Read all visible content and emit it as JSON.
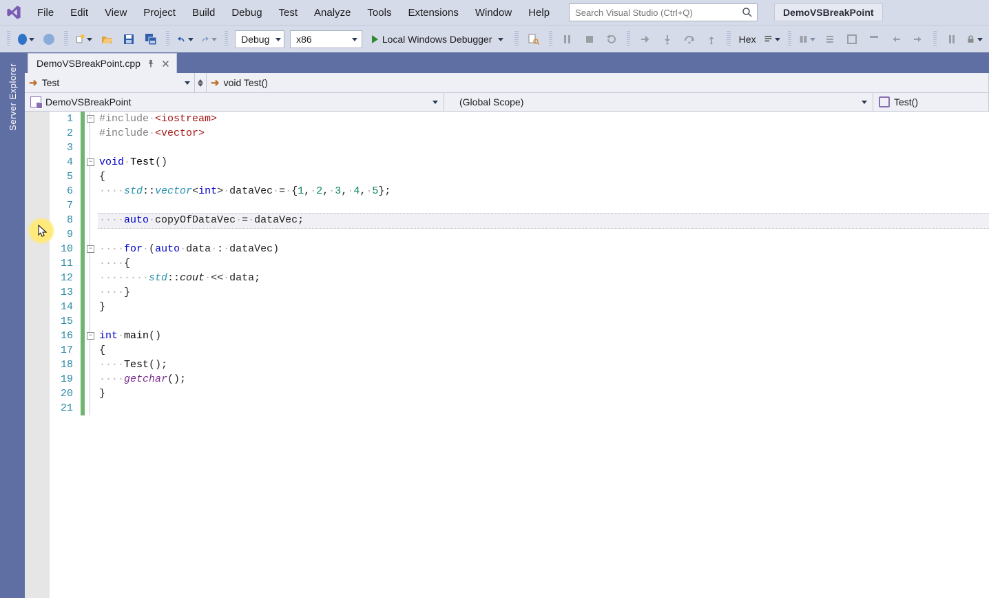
{
  "app": {
    "solution_name": "DemoVSBreakPoint",
    "search_placeholder": "Search Visual Studio (Ctrl+Q)"
  },
  "menus": [
    "File",
    "Edit",
    "View",
    "Project",
    "Build",
    "Debug",
    "Test",
    "Analyze",
    "Tools",
    "Extensions",
    "Window",
    "Help"
  ],
  "toolbar": {
    "config": "Debug",
    "platform": "x86",
    "debugger_label": "Local Windows Debugger",
    "hex_label": "Hex"
  },
  "sidepanel": {
    "server_explorer": "Server Explorer"
  },
  "tab": {
    "filename": "DemoVSBreakPoint.cpp"
  },
  "nav": {
    "class_combo": "Test",
    "func_combo": "void Test()"
  },
  "scope": {
    "project": "DemoVSBreakPoint",
    "scope": "(Global Scope)",
    "function": "Test()"
  },
  "code": {
    "highlight_line": 8,
    "lines": [
      {
        "n": 1,
        "outline": "minus",
        "seg": [
          [
            "pre",
            "#include"
          ],
          [
            "dots",
            "·"
          ],
          [
            "str",
            "<iostream>"
          ]
        ]
      },
      {
        "n": 2,
        "seg": [
          [
            "pre",
            "#include"
          ],
          [
            "dots",
            "·"
          ],
          [
            "str",
            "<vector>"
          ]
        ]
      },
      {
        "n": 3,
        "seg": []
      },
      {
        "n": 4,
        "outline": "minus",
        "seg": [
          [
            "kw",
            "void"
          ],
          [
            "dots",
            "·"
          ],
          [
            "fn",
            "Test"
          ],
          [
            "id",
            "()"
          ]
        ]
      },
      {
        "n": 5,
        "seg": [
          [
            "id",
            "{"
          ]
        ]
      },
      {
        "n": 6,
        "seg": [
          [
            "dots",
            "····"
          ],
          [
            "em",
            "std"
          ],
          [
            "id",
            "::"
          ],
          [
            "em",
            "vector"
          ],
          [
            "id",
            "<"
          ],
          [
            "kw",
            "int"
          ],
          [
            "id",
            ">"
          ],
          [
            "dots",
            "·"
          ],
          [
            "id",
            "dataVec"
          ],
          [
            "dots",
            "·"
          ],
          [
            "id",
            "="
          ],
          [
            "dots",
            "·"
          ],
          [
            "id",
            "{"
          ],
          [
            "num",
            "1"
          ],
          [
            "id",
            ","
          ],
          [
            "dots",
            "·"
          ],
          [
            "num",
            "2"
          ],
          [
            "id",
            ","
          ],
          [
            "dots",
            "·"
          ],
          [
            "num",
            "3"
          ],
          [
            "id",
            ","
          ],
          [
            "dots",
            "·"
          ],
          [
            "num",
            "4"
          ],
          [
            "id",
            ","
          ],
          [
            "dots",
            "·"
          ],
          [
            "num",
            "5"
          ],
          [
            "id",
            "};"
          ]
        ]
      },
      {
        "n": 7,
        "seg": []
      },
      {
        "n": 8,
        "seg": [
          [
            "dots",
            "····"
          ],
          [
            "kw",
            "auto"
          ],
          [
            "dots",
            "·"
          ],
          [
            "id",
            "copyOfDataVec"
          ],
          [
            "dots",
            "·"
          ],
          [
            "id",
            "="
          ],
          [
            "dots",
            "·"
          ],
          [
            "id",
            "dataVec;"
          ]
        ]
      },
      {
        "n": 9,
        "seg": []
      },
      {
        "n": 10,
        "outline": "minus",
        "seg": [
          [
            "dots",
            "····"
          ],
          [
            "kw",
            "for"
          ],
          [
            "dots",
            "·"
          ],
          [
            "id",
            "("
          ],
          [
            "kw",
            "auto"
          ],
          [
            "dots",
            "·"
          ],
          [
            "id",
            "data"
          ],
          [
            "dots",
            "·"
          ],
          [
            "id",
            ":"
          ],
          [
            "dots",
            "·"
          ],
          [
            "id",
            "dataVec)"
          ]
        ]
      },
      {
        "n": 11,
        "seg": [
          [
            "dots",
            "····"
          ],
          [
            "id",
            "{"
          ]
        ]
      },
      {
        "n": 12,
        "seg": [
          [
            "dots",
            "········"
          ],
          [
            "em",
            "std"
          ],
          [
            "id",
            "::"
          ],
          [
            "it",
            "cout"
          ],
          [
            "dots",
            "·"
          ],
          [
            "id",
            "<<"
          ],
          [
            "dots",
            "·"
          ],
          [
            "id",
            "data;"
          ]
        ]
      },
      {
        "n": 13,
        "seg": [
          [
            "dots",
            "····"
          ],
          [
            "id",
            "}"
          ]
        ]
      },
      {
        "n": 14,
        "seg": [
          [
            "id",
            "}"
          ]
        ]
      },
      {
        "n": 15,
        "seg": []
      },
      {
        "n": 16,
        "outline": "minus",
        "seg": [
          [
            "kw",
            "int"
          ],
          [
            "dots",
            "·"
          ],
          [
            "fn",
            "main"
          ],
          [
            "id",
            "()"
          ]
        ]
      },
      {
        "n": 17,
        "seg": [
          [
            "id",
            "{"
          ]
        ]
      },
      {
        "n": 18,
        "seg": [
          [
            "dots",
            "····"
          ],
          [
            "fn",
            "Test"
          ],
          [
            "id",
            "();"
          ]
        ]
      },
      {
        "n": 19,
        "seg": [
          [
            "dots",
            "····"
          ],
          [
            "getc",
            "getchar"
          ],
          [
            "id",
            "();"
          ]
        ]
      },
      {
        "n": 20,
        "seg": [
          [
            "id",
            "}"
          ]
        ]
      },
      {
        "n": 21,
        "seg": []
      }
    ]
  }
}
